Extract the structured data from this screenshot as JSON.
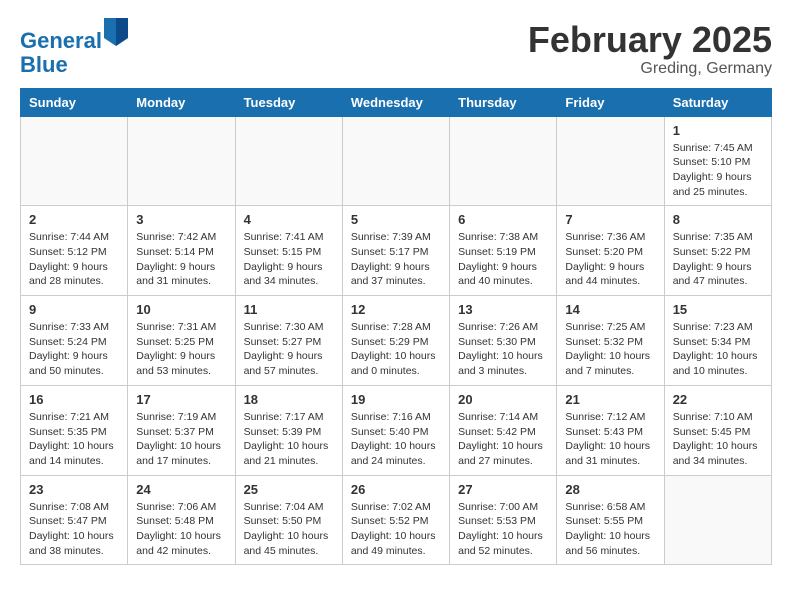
{
  "header": {
    "logo_line1": "General",
    "logo_line2": "Blue",
    "month_title": "February 2025",
    "location": "Greding, Germany"
  },
  "weekdays": [
    "Sunday",
    "Monday",
    "Tuesday",
    "Wednesday",
    "Thursday",
    "Friday",
    "Saturday"
  ],
  "weeks": [
    [
      {
        "day": "",
        "info": ""
      },
      {
        "day": "",
        "info": ""
      },
      {
        "day": "",
        "info": ""
      },
      {
        "day": "",
        "info": ""
      },
      {
        "day": "",
        "info": ""
      },
      {
        "day": "",
        "info": ""
      },
      {
        "day": "1",
        "info": "Sunrise: 7:45 AM\nSunset: 5:10 PM\nDaylight: 9 hours and 25 minutes."
      }
    ],
    [
      {
        "day": "2",
        "info": "Sunrise: 7:44 AM\nSunset: 5:12 PM\nDaylight: 9 hours and 28 minutes."
      },
      {
        "day": "3",
        "info": "Sunrise: 7:42 AM\nSunset: 5:14 PM\nDaylight: 9 hours and 31 minutes."
      },
      {
        "day": "4",
        "info": "Sunrise: 7:41 AM\nSunset: 5:15 PM\nDaylight: 9 hours and 34 minutes."
      },
      {
        "day": "5",
        "info": "Sunrise: 7:39 AM\nSunset: 5:17 PM\nDaylight: 9 hours and 37 minutes."
      },
      {
        "day": "6",
        "info": "Sunrise: 7:38 AM\nSunset: 5:19 PM\nDaylight: 9 hours and 40 minutes."
      },
      {
        "day": "7",
        "info": "Sunrise: 7:36 AM\nSunset: 5:20 PM\nDaylight: 9 hours and 44 minutes."
      },
      {
        "day": "8",
        "info": "Sunrise: 7:35 AM\nSunset: 5:22 PM\nDaylight: 9 hours and 47 minutes."
      }
    ],
    [
      {
        "day": "9",
        "info": "Sunrise: 7:33 AM\nSunset: 5:24 PM\nDaylight: 9 hours and 50 minutes."
      },
      {
        "day": "10",
        "info": "Sunrise: 7:31 AM\nSunset: 5:25 PM\nDaylight: 9 hours and 53 minutes."
      },
      {
        "day": "11",
        "info": "Sunrise: 7:30 AM\nSunset: 5:27 PM\nDaylight: 9 hours and 57 minutes."
      },
      {
        "day": "12",
        "info": "Sunrise: 7:28 AM\nSunset: 5:29 PM\nDaylight: 10 hours and 0 minutes."
      },
      {
        "day": "13",
        "info": "Sunrise: 7:26 AM\nSunset: 5:30 PM\nDaylight: 10 hours and 3 minutes."
      },
      {
        "day": "14",
        "info": "Sunrise: 7:25 AM\nSunset: 5:32 PM\nDaylight: 10 hours and 7 minutes."
      },
      {
        "day": "15",
        "info": "Sunrise: 7:23 AM\nSunset: 5:34 PM\nDaylight: 10 hours and 10 minutes."
      }
    ],
    [
      {
        "day": "16",
        "info": "Sunrise: 7:21 AM\nSunset: 5:35 PM\nDaylight: 10 hours and 14 minutes."
      },
      {
        "day": "17",
        "info": "Sunrise: 7:19 AM\nSunset: 5:37 PM\nDaylight: 10 hours and 17 minutes."
      },
      {
        "day": "18",
        "info": "Sunrise: 7:17 AM\nSunset: 5:39 PM\nDaylight: 10 hours and 21 minutes."
      },
      {
        "day": "19",
        "info": "Sunrise: 7:16 AM\nSunset: 5:40 PM\nDaylight: 10 hours and 24 minutes."
      },
      {
        "day": "20",
        "info": "Sunrise: 7:14 AM\nSunset: 5:42 PM\nDaylight: 10 hours and 27 minutes."
      },
      {
        "day": "21",
        "info": "Sunrise: 7:12 AM\nSunset: 5:43 PM\nDaylight: 10 hours and 31 minutes."
      },
      {
        "day": "22",
        "info": "Sunrise: 7:10 AM\nSunset: 5:45 PM\nDaylight: 10 hours and 34 minutes."
      }
    ],
    [
      {
        "day": "23",
        "info": "Sunrise: 7:08 AM\nSunset: 5:47 PM\nDaylight: 10 hours and 38 minutes."
      },
      {
        "day": "24",
        "info": "Sunrise: 7:06 AM\nSunset: 5:48 PM\nDaylight: 10 hours and 42 minutes."
      },
      {
        "day": "25",
        "info": "Sunrise: 7:04 AM\nSunset: 5:50 PM\nDaylight: 10 hours and 45 minutes."
      },
      {
        "day": "26",
        "info": "Sunrise: 7:02 AM\nSunset: 5:52 PM\nDaylight: 10 hours and 49 minutes."
      },
      {
        "day": "27",
        "info": "Sunrise: 7:00 AM\nSunset: 5:53 PM\nDaylight: 10 hours and 52 minutes."
      },
      {
        "day": "28",
        "info": "Sunrise: 6:58 AM\nSunset: 5:55 PM\nDaylight: 10 hours and 56 minutes."
      },
      {
        "day": "",
        "info": ""
      }
    ]
  ]
}
